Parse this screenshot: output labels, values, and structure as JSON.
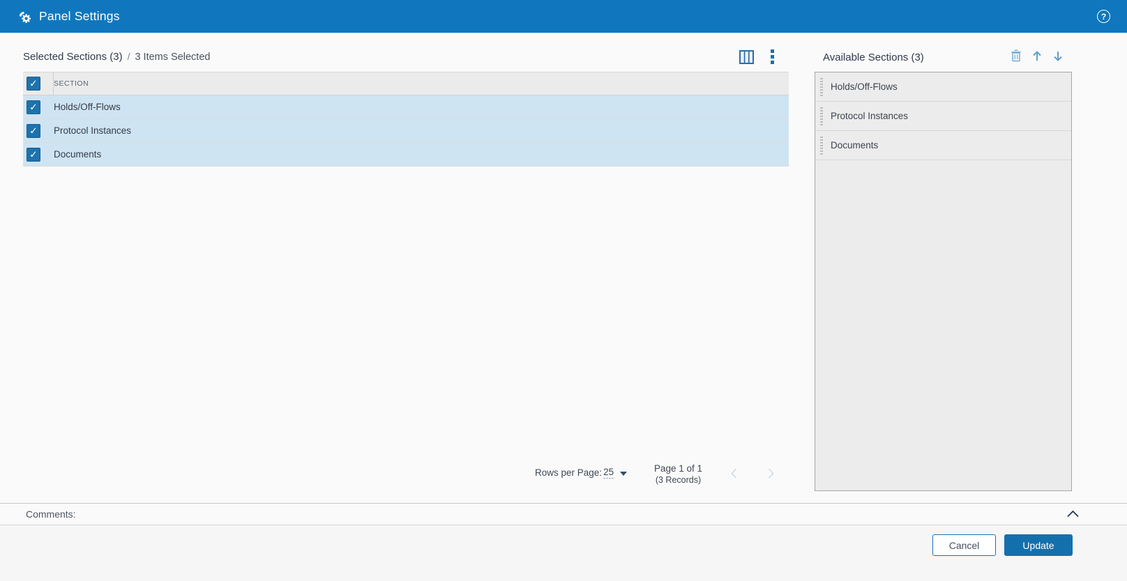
{
  "header": {
    "title": "Panel Settings"
  },
  "icons": {
    "help_glyph": "?",
    "check_glyph": "✓"
  },
  "selected_panel": {
    "title": "Selected Sections (3)",
    "divider": "/",
    "subtitle": "3 Items Selected",
    "column_header": "SECTION",
    "rows": [
      {
        "label": "Holds/Off-Flows",
        "checked": true
      },
      {
        "label": "Protocol Instances",
        "checked": true
      },
      {
        "label": "Documents",
        "checked": true
      }
    ],
    "pagination": {
      "rows_per_page_label": "Rows per Page:",
      "rows_per_page_value": "25",
      "page_info": "Page 1 of 1",
      "records_info": "(3 Records)"
    }
  },
  "available_panel": {
    "title": "Available Sections (3)",
    "items": [
      {
        "label": "Holds/Off-Flows"
      },
      {
        "label": "Protocol Instances"
      },
      {
        "label": "Documents"
      }
    ]
  },
  "footer": {
    "comments_label": "Comments:",
    "cancel_label": "Cancel",
    "update_label": "Update"
  },
  "colors": {
    "topbar_blue": "#1077be",
    "checkbox_blue": "#1e72ad",
    "row_selected_blue": "#cfe4f2",
    "update_button_blue": "#1470ad",
    "icon_light_blue": "#6aa7d8",
    "panel_gray": "#ececec"
  }
}
